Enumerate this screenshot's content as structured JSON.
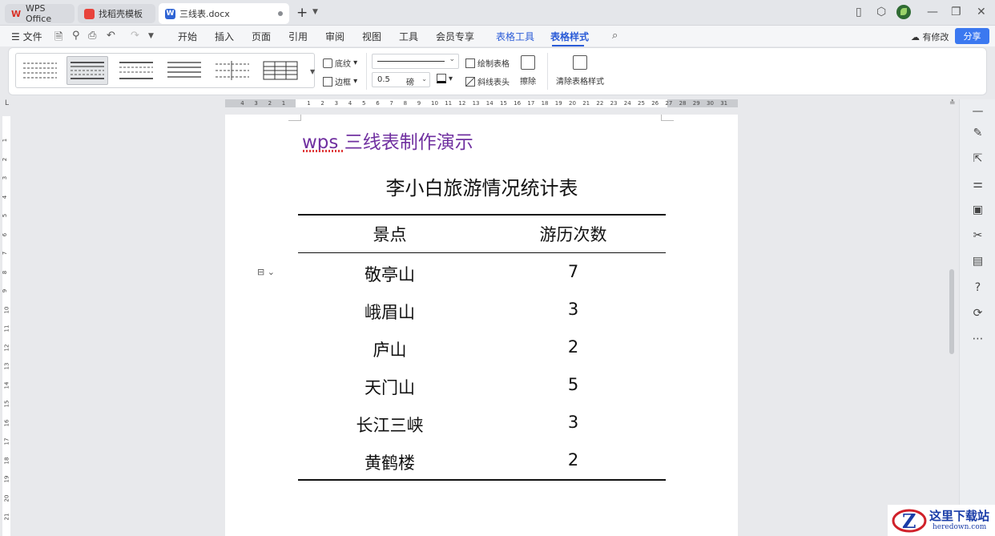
{
  "tabs": [
    {
      "label": "WPS Office",
      "icon": "wps-logo-icon"
    },
    {
      "label": "找稻壳模板",
      "icon": "docer-icon"
    },
    {
      "label": "三线表.docx",
      "icon": "word-doc-icon"
    }
  ],
  "menu": {
    "file": "文件",
    "items": [
      "开始",
      "插入",
      "页面",
      "引用",
      "审阅",
      "视图",
      "工具",
      "会员专享",
      "表格工具",
      "表格样式"
    ],
    "active": "表格样式",
    "edit_status": "有修改",
    "share": "分享"
  },
  "ribbon": {
    "shading": "底纹",
    "border": "边框",
    "line_width": "0.5",
    "line_unit": "磅",
    "draw_table": "绘制表格",
    "diagonal_header": "斜线表头",
    "erase": "擦除",
    "clear_style": "清除表格样式"
  },
  "ruler": {
    "left_numbers": [
      "4",
      "3",
      "2",
      "1"
    ],
    "right_numbers": [
      "1",
      "2",
      "3",
      "4",
      "5",
      "6",
      "7",
      "8",
      "9",
      "10",
      "11",
      "12",
      "13",
      "14",
      "15",
      "16",
      "17",
      "18",
      "19",
      "20",
      "21",
      "22",
      "23",
      "24",
      "25",
      "26",
      "27",
      "28",
      "29",
      "30",
      "31"
    ],
    "vertical_numbers": [
      "1",
      "2",
      "3",
      "4",
      "5",
      "6",
      "7",
      "8",
      "9",
      "10",
      "11",
      "12",
      "13",
      "14",
      "15",
      "16",
      "17",
      "18",
      "19",
      "20",
      "21"
    ]
  },
  "document": {
    "heading": "wps 三线表制作演示",
    "table_title": "李小白旅游情况统计表",
    "headers": [
      "景点",
      "游历次数"
    ],
    "rows": [
      [
        "敬亭山",
        "7"
      ],
      [
        "峨眉山",
        "3"
      ],
      [
        "庐山",
        "2"
      ],
      [
        "天门山",
        "5"
      ],
      [
        "长江三峡",
        "3"
      ],
      [
        "黄鹤楼",
        "2"
      ]
    ]
  },
  "watermark": {
    "title": "这里下载站",
    "url": "heredown.com"
  },
  "colors": {
    "accent": "#2a5bd7",
    "heading": "#7030a0",
    "share_button": "#3b78f0"
  }
}
